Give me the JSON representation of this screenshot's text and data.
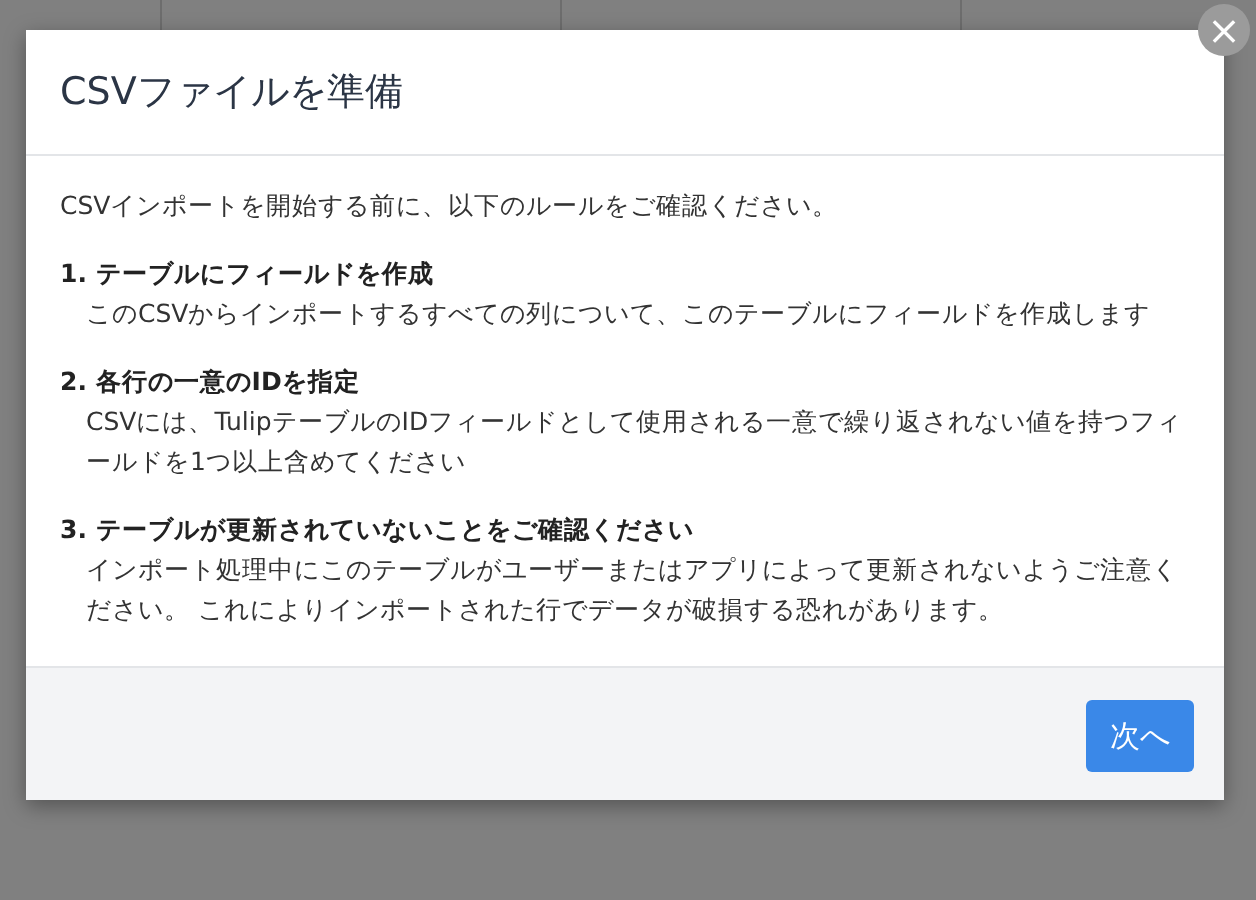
{
  "dialog": {
    "title": "CSVファイルを準備",
    "intro": "CSVインポートを開始する前に、以下のルールをご確認ください。",
    "rules": [
      {
        "number": "1.",
        "heading": "テーブルにフィールドを作成",
        "text": "このCSVからインポートするすべての列について、このテーブルにフィールドを作成します"
      },
      {
        "number": "2.",
        "heading": "各行の一意のIDを指定",
        "text": "CSVには、TulipテーブルのIDフィールドとして使用される一意で繰り返されない値を持つフィールドを1つ以上含めてください"
      },
      {
        "number": "3.",
        "heading": "テーブルが更新されていないことをご確認ください",
        "text": "インポート処理中にこのテーブルがユーザーまたはアプリによって更新されないようご注意ください。 これによりインポートされた行でデータが破損する恐れがあります。"
      }
    ],
    "close_button": "×",
    "next_button": "次へ"
  }
}
